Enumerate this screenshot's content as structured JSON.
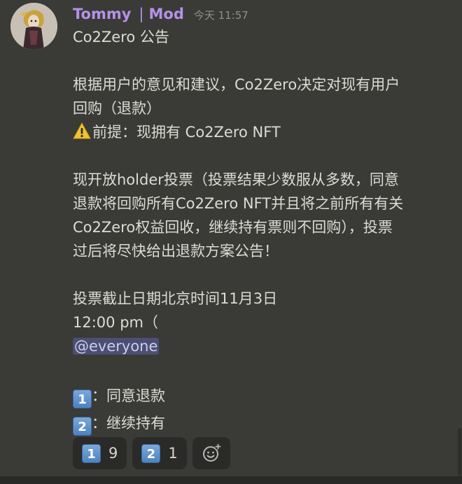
{
  "message": {
    "username": "Tommy",
    "separator": "|",
    "role": "Mod",
    "timestamp": "今天 11:57",
    "lines": {
      "l1": "Co2Zero 公告",
      "l2": "根据用户的意见和建议，Co2Zero决定对现有用户",
      "l3": "回购（退款）",
      "l4": "前提：现拥有 Co2Zero NFT",
      "l5": "现开放holder投票（投票结果少数服从多数，同意",
      "l6": "退款将回购所有Co2Zero NFT并且将之前所有有关",
      "l7": "Co2Zero权益回收，继续持有票则不回购），投票",
      "l8": "过后将尽快给出退款方案公告！",
      "l9": "投票截止日期北京时间11月3日",
      "l10": "12:00 pm（",
      "mention": "@everyone",
      "opt1_key": "1",
      "opt1_text": "：同意退款",
      "opt2_key": "2",
      "opt2_text": "：继续持有"
    }
  },
  "reactions": [
    {
      "emoji": "1",
      "count": "9"
    },
    {
      "emoji": "2",
      "count": "1"
    }
  ],
  "icons": {
    "warning": "warning-icon",
    "add_reaction": "add-reaction-icon"
  },
  "colors": {
    "background": "#3a3a37",
    "username": "#b592e8",
    "mention_bg": "#4c4f6f",
    "keycap": "#5b8fcc"
  }
}
